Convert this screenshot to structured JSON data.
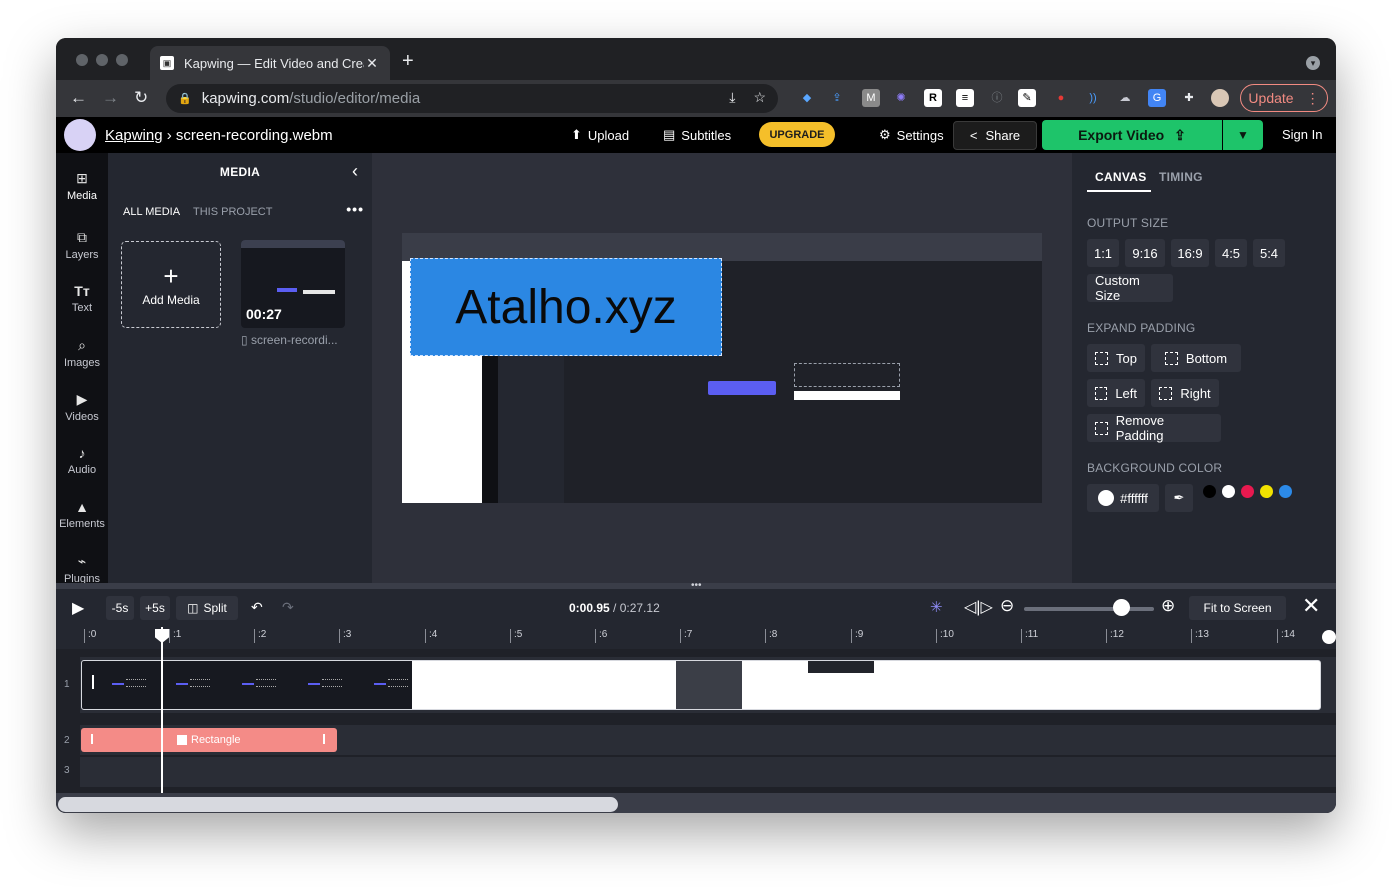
{
  "browser": {
    "tab_title": "Kapwing — Edit Video and Crea",
    "url_host": "kapwing.com",
    "url_path": "/studio/editor/media",
    "update_label": "Update"
  },
  "header": {
    "brand": "Kapwing",
    "separator": "›",
    "filename": "screen-recording.webm",
    "upload": "Upload",
    "subtitles": "Subtitles",
    "upgrade": "UPGRADE",
    "settings": "Settings",
    "share": "Share",
    "export": "Export Video",
    "signin": "Sign In"
  },
  "rail": [
    {
      "icon": "media-icon",
      "label": "Media"
    },
    {
      "icon": "layers-icon",
      "label": "Layers"
    },
    {
      "icon": "text-icon",
      "label": "Text"
    },
    {
      "icon": "images-icon",
      "label": "Images"
    },
    {
      "icon": "videos-icon",
      "label": "Videos"
    },
    {
      "icon": "audio-icon",
      "label": "Audio"
    },
    {
      "icon": "elements-icon",
      "label": "Elements"
    },
    {
      "icon": "plugins-icon",
      "label": "Plugins"
    }
  ],
  "media": {
    "title": "MEDIA",
    "tab_all": "ALL MEDIA",
    "tab_project": "THIS PROJECT",
    "add": "Add Media",
    "duration": "00:27",
    "item_name": "screen-recordi..."
  },
  "canvas": {
    "overlay_text": "Atalho.xyz"
  },
  "right_panel": {
    "tab_canvas": "CANVAS",
    "tab_timing": "TIMING",
    "output_size": "OUTPUT SIZE",
    "ratios": [
      "1:1",
      "9:16",
      "16:9",
      "4:5",
      "5:4"
    ],
    "custom_size": "Custom Size",
    "expand_padding": "EXPAND PADDING",
    "top": "Top",
    "bottom": "Bottom",
    "left": "Left",
    "right": "Right",
    "remove_padding": "Remove Padding",
    "background_color": "BACKGROUND COLOR",
    "color_value": "#ffffff",
    "swatches": [
      "#000000",
      "#ffffff",
      "#e8194f",
      "#f2e200",
      "#2c8ae8"
    ]
  },
  "timeline_toolbar": {
    "minus5": "-5s",
    "plus5": "+5s",
    "split": "Split",
    "current_time": "0:00.95",
    "total_time": " / 0:27.12",
    "fit": "Fit to Screen",
    "zoom_level": 0.76
  },
  "timeline": {
    "ticks": [
      ":0",
      ":1",
      ":2",
      ":3",
      ":4",
      ":5",
      ":6",
      ":7",
      ":8",
      ":9",
      ":10",
      ":11",
      ":12",
      ":13",
      ":14"
    ],
    "tracks": [
      "1",
      "2",
      "3"
    ],
    "rect_label": "Rectangle"
  },
  "colors": {
    "accent_green": "#1ec46a",
    "upgrade_yellow": "#f5bf2a",
    "rectangle_blue": "#2b87e3",
    "rect_clip_pink": "#f48b87"
  }
}
